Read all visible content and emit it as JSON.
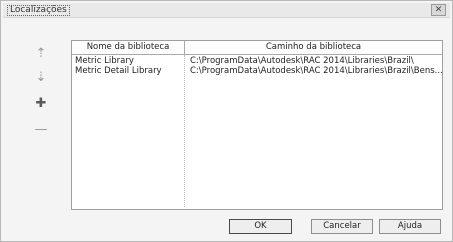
{
  "dialog": {
    "title": "Localizações",
    "close_glyph": "✕"
  },
  "toolbar": {
    "items": [
      {
        "icon": "move-up-icon",
        "glyph": "⇡"
      },
      {
        "icon": "move-down-icon",
        "glyph": "⇣"
      },
      {
        "icon": "add-icon",
        "glyph": "✚"
      },
      {
        "icon": "remove-icon",
        "glyph": "—"
      }
    ]
  },
  "table": {
    "headers": {
      "name": "Nome da biblioteca",
      "path": "Caminho da biblioteca"
    },
    "rows": [
      {
        "name": "Metric Library",
        "path": "C:\\ProgramData\\Autodesk\\RAC 2014\\Libraries\\Brazil\\"
      },
      {
        "name": "Metric Detail Library",
        "path": "C:\\ProgramData\\Autodesk\\RAC 2014\\Libraries\\Brazil\\Bens..."
      }
    ]
  },
  "buttons": {
    "ok": "OK",
    "cancel": "Cancelar",
    "help": "Ajuda"
  }
}
